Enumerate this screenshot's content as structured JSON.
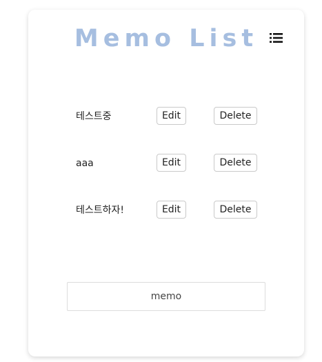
{
  "header": {
    "title": "Memo List",
    "menu_icon": "list-icon",
    "title_color": "#a6bee0"
  },
  "memos": [
    {
      "text": "테스트중",
      "edit_label": "Edit",
      "delete_label": "Delete"
    },
    {
      "text": "aaa",
      "edit_label": "Edit",
      "delete_label": "Delete"
    },
    {
      "text": "테스트하자!",
      "edit_label": "Edit",
      "delete_label": "Delete"
    }
  ],
  "input": {
    "placeholder": "memo",
    "value": ""
  }
}
